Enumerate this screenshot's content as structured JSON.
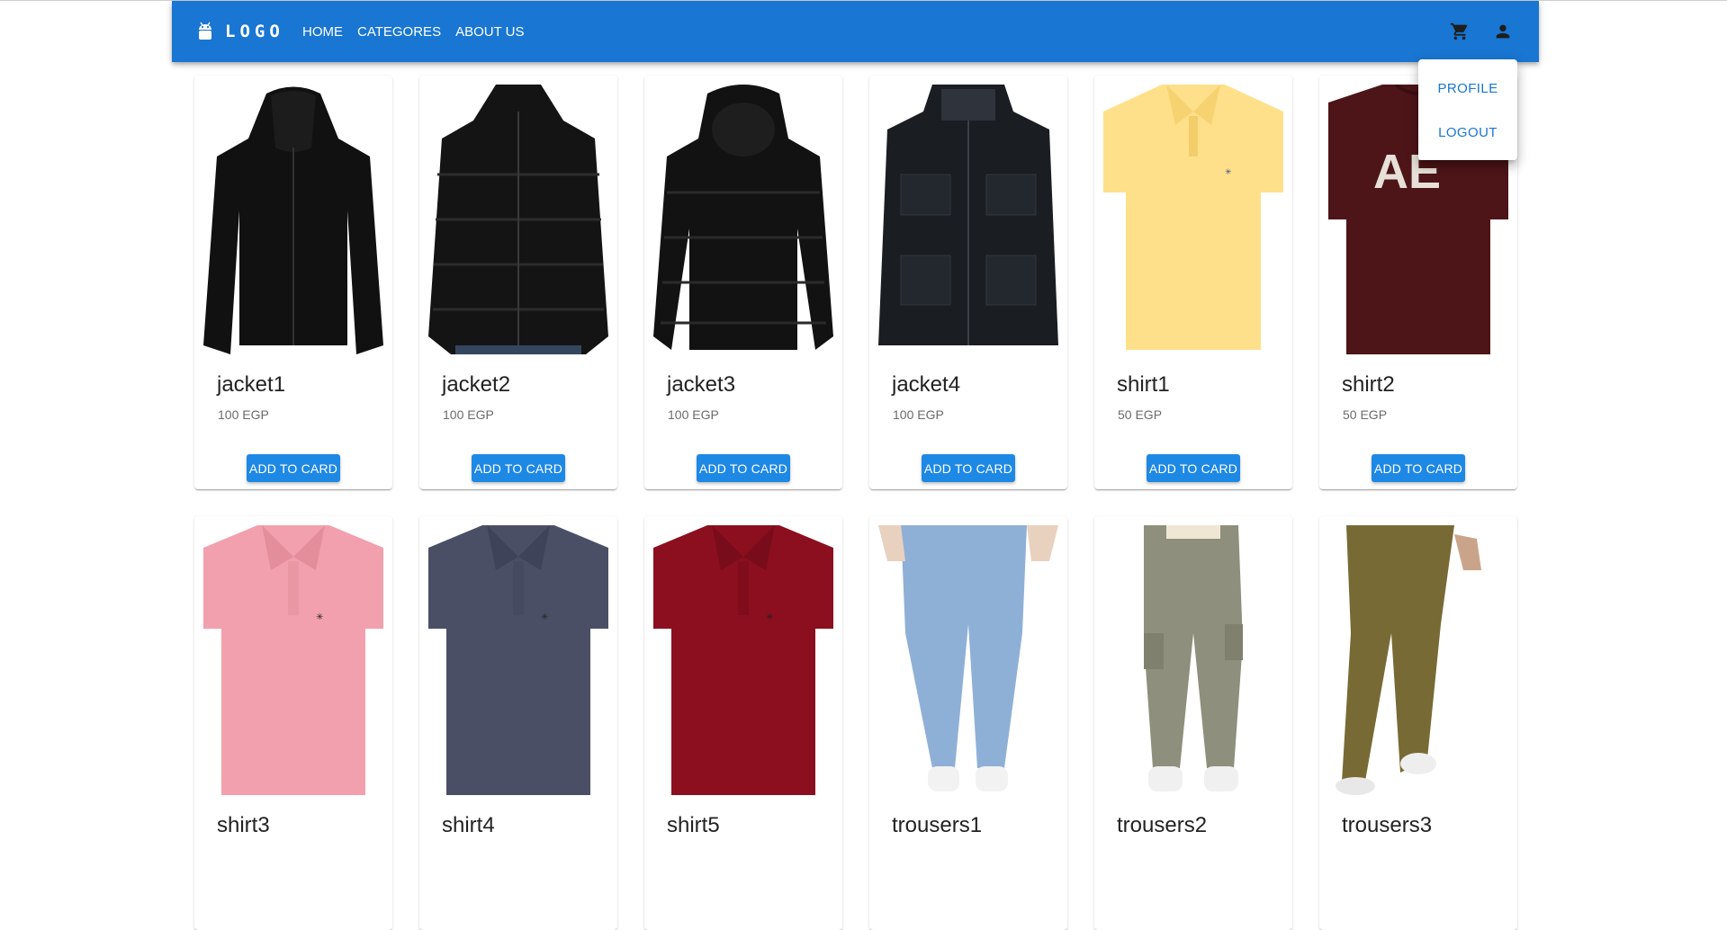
{
  "brand": {
    "logo_text": "LOGO",
    "icon": "android-icon"
  },
  "nav": [
    {
      "label": "HOME"
    },
    {
      "label": "CATEGORES"
    },
    {
      "label": "ABOUT US"
    }
  ],
  "actions": {
    "cart_icon": "shopping-cart-icon",
    "account_icon": "account-icon"
  },
  "account_menu": [
    {
      "label": "PROFILE"
    },
    {
      "label": "LOGOUT"
    }
  ],
  "colors": {
    "primary": "#1976d2",
    "button": "#1e88e5"
  },
  "products": [
    {
      "name": "jacket1",
      "price": "100 EGP",
      "button": "ADD TO CARD",
      "image": "black-zip-hoodie"
    },
    {
      "name": "jacket2",
      "price": "100 EGP",
      "button": "ADD TO CARD",
      "image": "black-puffer-jacket"
    },
    {
      "name": "jacket3",
      "price": "100 EGP",
      "button": "ADD TO CARD",
      "image": "black-down-jacket"
    },
    {
      "name": "jacket4",
      "price": "100 EGP",
      "button": "ADD TO CARD",
      "image": "black-field-jacket"
    },
    {
      "name": "shirt1",
      "price": "50 EGP",
      "button": "ADD TO CARD",
      "image": "yellow-polo-shirt"
    },
    {
      "name": "shirt2",
      "price": "50 EGP",
      "button": "ADD TO CARD",
      "image": "maroon-graphic-tshirt"
    },
    {
      "name": "shirt3",
      "price": "",
      "button": "",
      "image": "pink-polo-shirt"
    },
    {
      "name": "shirt4",
      "price": "",
      "button": "",
      "image": "navy-polo-shirt"
    },
    {
      "name": "shirt5",
      "price": "",
      "button": "",
      "image": "red-polo-shirt"
    },
    {
      "name": "trousers1",
      "price": "",
      "button": "",
      "image": "blue-jeans"
    },
    {
      "name": "trousers2",
      "price": "",
      "button": "",
      "image": "grey-cargo-trousers"
    },
    {
      "name": "trousers3",
      "price": "",
      "button": "",
      "image": "olive-chino-trousers"
    }
  ]
}
